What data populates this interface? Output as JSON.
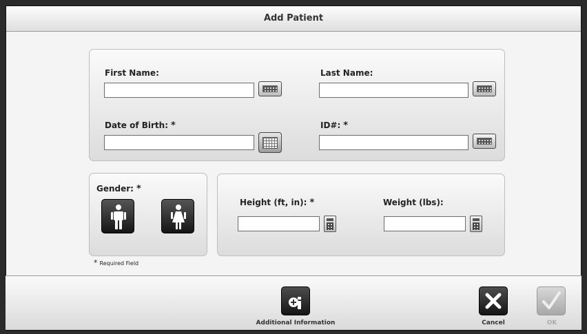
{
  "dialog": {
    "title": "Add Patient"
  },
  "patient_form": {
    "first_name": {
      "label": "First Name:",
      "value": ""
    },
    "last_name": {
      "label": "Last Name:",
      "value": ""
    },
    "date_of_birth": {
      "label": "Date of Birth:",
      "required_mark": "*",
      "value": ""
    },
    "id": {
      "label": "ID#:",
      "required_mark": "*",
      "value": ""
    }
  },
  "gender": {
    "label": "Gender:",
    "required_mark": "*",
    "options": [
      "male",
      "female"
    ]
  },
  "measurements": {
    "height": {
      "label": "Height (ft, in):",
      "required_mark": "*",
      "value": ""
    },
    "weight": {
      "label": "Weight (lbs):",
      "value": ""
    }
  },
  "required_note": {
    "mark": "*",
    "text": "Required Field"
  },
  "footer": {
    "additional_info_label": "Additional Information",
    "cancel_label": "Cancel",
    "ok_label": "OK"
  },
  "icons": {
    "keyboard": "keyboard-icon",
    "calendar": "calendar-icon",
    "calculator": "calculator-icon",
    "male": "male-icon",
    "female": "female-icon",
    "info": "info-icon",
    "cancel": "close-icon",
    "ok": "checkmark-icon"
  }
}
